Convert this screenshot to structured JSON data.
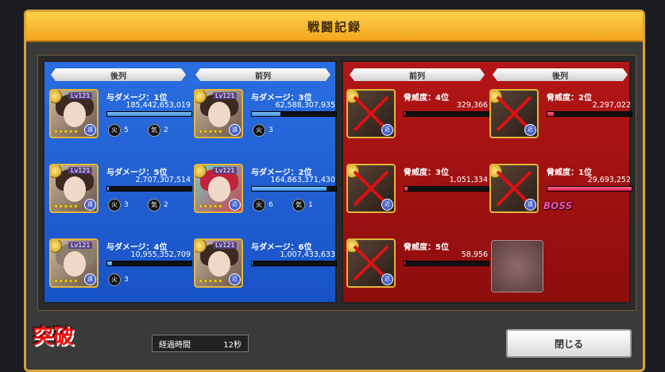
{
  "title": "戦闘記録",
  "ally": {
    "headers": [
      "後列",
      "前列"
    ],
    "units": [
      {
        "rank": "与ダメージ：1位",
        "value": "185,442,653,019",
        "level": "Lv121",
        "fill": 1.0,
        "stats": [
          {
            "label": "火",
            "val": "5"
          },
          {
            "label": "気",
            "val": "2"
          }
        ]
      },
      {
        "rank": "与ダメージ：3位",
        "value": "62,588,307,935",
        "level": "Lv121",
        "fill": 0.34,
        "stats": [
          {
            "label": "火",
            "val": "3"
          }
        ]
      },
      {
        "rank": "与ダメージ：5位",
        "value": "2,707,307,514",
        "level": "Lv121",
        "fill": 0.02,
        "stats": [
          {
            "label": "火",
            "val": "3"
          },
          {
            "label": "気",
            "val": "2"
          }
        ]
      },
      {
        "rank": "与ダメージ：2位",
        "value": "164,863,371,430",
        "level": "Lv121",
        "fill": 0.89,
        "stats": [
          {
            "label": "火",
            "val": "6"
          },
          {
            "label": "気",
            "val": "1"
          }
        ]
      },
      {
        "rank": "与ダメージ：4位",
        "value": "10,955,352,709",
        "level": "Lv121",
        "fill": 0.06,
        "stats": [
          {
            "label": "火",
            "val": "3"
          }
        ]
      },
      {
        "rank": "与ダメージ：6位",
        "value": "1,007,433,633",
        "level": "Lv121",
        "fill": 0.01,
        "stats": []
      }
    ]
  },
  "enemy": {
    "headers": [
      "前列",
      "後列"
    ],
    "units": [
      {
        "rank": "脅威度：4位",
        "value": "329,366",
        "fill": 0.01
      },
      {
        "rank": "脅威度：2位",
        "value": "2,297,022",
        "fill": 0.08
      },
      {
        "rank": "脅威度：3位",
        "value": "1,051,334",
        "fill": 0.04
      },
      {
        "rank": "脅威度：1位",
        "value": "29,693,252",
        "fill": 1.0,
        "boss": "BOSS"
      },
      {
        "rank": "脅威度：5位",
        "value": "58,956",
        "fill": 0.002
      }
    ]
  },
  "footer": {
    "logo": "突破",
    "elapsed_label": "経過時間",
    "elapsed_value": "12秒",
    "close_label": "閉じる"
  },
  "colors": {
    "ally_panel": "#1852c6",
    "enemy_panel": "#8e0d0d",
    "title_bar": "#f2a51d"
  }
}
